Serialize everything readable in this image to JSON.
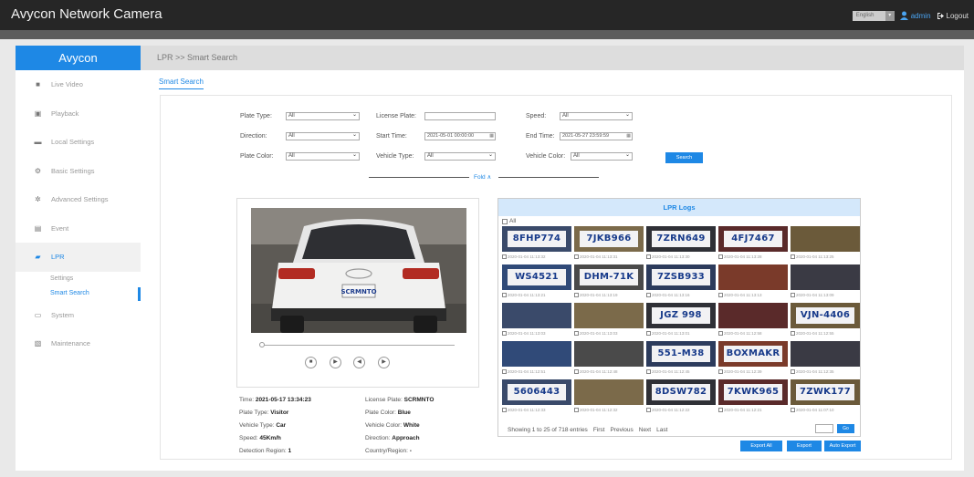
{
  "app": {
    "title": "Avycon Network Camera"
  },
  "topbar": {
    "language": "English",
    "user": "admin",
    "logout": "Logout"
  },
  "sidebar": {
    "logo": "Avycon",
    "items": [
      {
        "label": "Live Video",
        "icon": "video-camera-icon"
      },
      {
        "label": "Playback",
        "icon": "film-icon"
      },
      {
        "label": "Local Settings",
        "icon": "folder-icon"
      },
      {
        "label": "Basic Settings",
        "icon": "gear-icon"
      },
      {
        "label": "Advanced Settings",
        "icon": "gears-icon"
      },
      {
        "label": "Event",
        "icon": "calendar-icon"
      },
      {
        "label": "LPR",
        "icon": "car-icon"
      },
      {
        "label": "System",
        "icon": "monitor-icon"
      },
      {
        "label": "Maintenance",
        "icon": "toolbox-icon"
      }
    ],
    "lpr_sub": [
      "Settings",
      "Smart Search"
    ]
  },
  "breadcrumb": "LPR >> Smart Search",
  "tab": "Smart Search",
  "filters": {
    "plate_type_label": "Plate Type:",
    "plate_type_value": "All",
    "license_plate_label": "License Plate:",
    "license_plate_value": "",
    "speed_label": "Speed:",
    "speed_value": "All",
    "direction_label": "Direction:",
    "direction_value": "All",
    "start_time_label": "Start Time:",
    "start_time_value": "2021-05-01 00:00:00",
    "end_time_label": "End Time:",
    "end_time_value": "2021-05-27 23:59:59",
    "plate_color_label": "Plate Color:",
    "plate_color_value": "All",
    "vehicle_type_label": "Vehicle Type:",
    "vehicle_type_value": "All",
    "vehicle_color_label": "Vehicle Color:",
    "vehicle_color_value": "All",
    "search": "Search",
    "fold": "Fold ∧"
  },
  "video": {
    "plate_text": "SCRMNTO",
    "badge": "audi"
  },
  "details": {
    "time_label": "Time:",
    "time": "2021-05-17 13:34:23",
    "plate_type_label": "Plate Type:",
    "plate_type": "Visitor",
    "vehicle_type_label": "Vehicle Type:",
    "vehicle_type": "Car",
    "speed_label": "Speed:",
    "speed": "45Km/h",
    "region_label": "Detection Region:",
    "region": "1",
    "license_label": "License Plate:",
    "license": "SCRMNTO",
    "plate_color_label": "Plate Color:",
    "plate_color": "Blue",
    "vehicle_color_label": "Vehicle Color:",
    "vehicle_color": "White",
    "direction_label": "Direction:",
    "direction": "Approach",
    "country_label": "Country/Region:",
    "country": "-"
  },
  "logs": {
    "title": "LPR Logs",
    "check_all": "All",
    "thumbs": [
      {
        "plate": "8FHP774",
        "time": "2020-01-04 11:13:32"
      },
      {
        "plate": "7JKB966",
        "time": "2020-01-04 11:13:31"
      },
      {
        "plate": "7ZRN649",
        "time": "2020-01-04 11:13:30"
      },
      {
        "plate": "4FJ7467",
        "time": "2020-01-04 11:13:28"
      },
      {
        "plate": "",
        "time": "2020-01-04 11:13:25"
      },
      {
        "plate": "WS4521",
        "time": "2020-01-04 11:13:21"
      },
      {
        "plate": "DHM-71K",
        "time": "2020-01-04 11:13:19"
      },
      {
        "plate": "7ZSB933",
        "time": "2020-01-04 11:13:16"
      },
      {
        "plate": "",
        "time": "2020-01-04 11:13:13"
      },
      {
        "plate": "",
        "time": "2020-01-04 11:13:09"
      },
      {
        "plate": "",
        "time": "2020-01-04 11:13:03"
      },
      {
        "plate": "",
        "time": "2020-01-04 11:13:03"
      },
      {
        "plate": "JGZ 998",
        "time": "2020-01-04 11:13:01"
      },
      {
        "plate": "",
        "time": "2020-01-04 11:12:58"
      },
      {
        "plate": "VJN-4406",
        "time": "2020-01-04 11:12:55"
      },
      {
        "plate": "",
        "time": "2020-01-04 11:12:51"
      },
      {
        "plate": "",
        "time": "2020-01-04 11:12:48"
      },
      {
        "plate": "551-M38",
        "time": "2020-01-04 11:12:45"
      },
      {
        "plate": "BOXMAKR",
        "time": "2020-01-04 11:12:39"
      },
      {
        "plate": "",
        "time": "2020-01-04 11:12:35"
      },
      {
        "plate": "5606443",
        "time": "2020-01-04 11:12:33"
      },
      {
        "plate": "",
        "time": "2020-01-04 11:12:32"
      },
      {
        "plate": "8DSW782",
        "time": "2020-01-04 11:12:22"
      },
      {
        "plate": "7KWK965",
        "time": "2020-01-04 11:12:21"
      },
      {
        "plate": "7ZWK177",
        "time": "2020-01-04 11:07:10"
      }
    ],
    "showing": "Showing 1 to 25 of 718 entries",
    "first": "First",
    "previous": "Previous",
    "next": "Next",
    "last": "Last",
    "go": "Go"
  },
  "actions": {
    "export_all": "Export All",
    "export": "Export",
    "auto_export": "Auto Export"
  },
  "colors": {
    "accent": "#1e88e5",
    "topbar": "#262626"
  }
}
